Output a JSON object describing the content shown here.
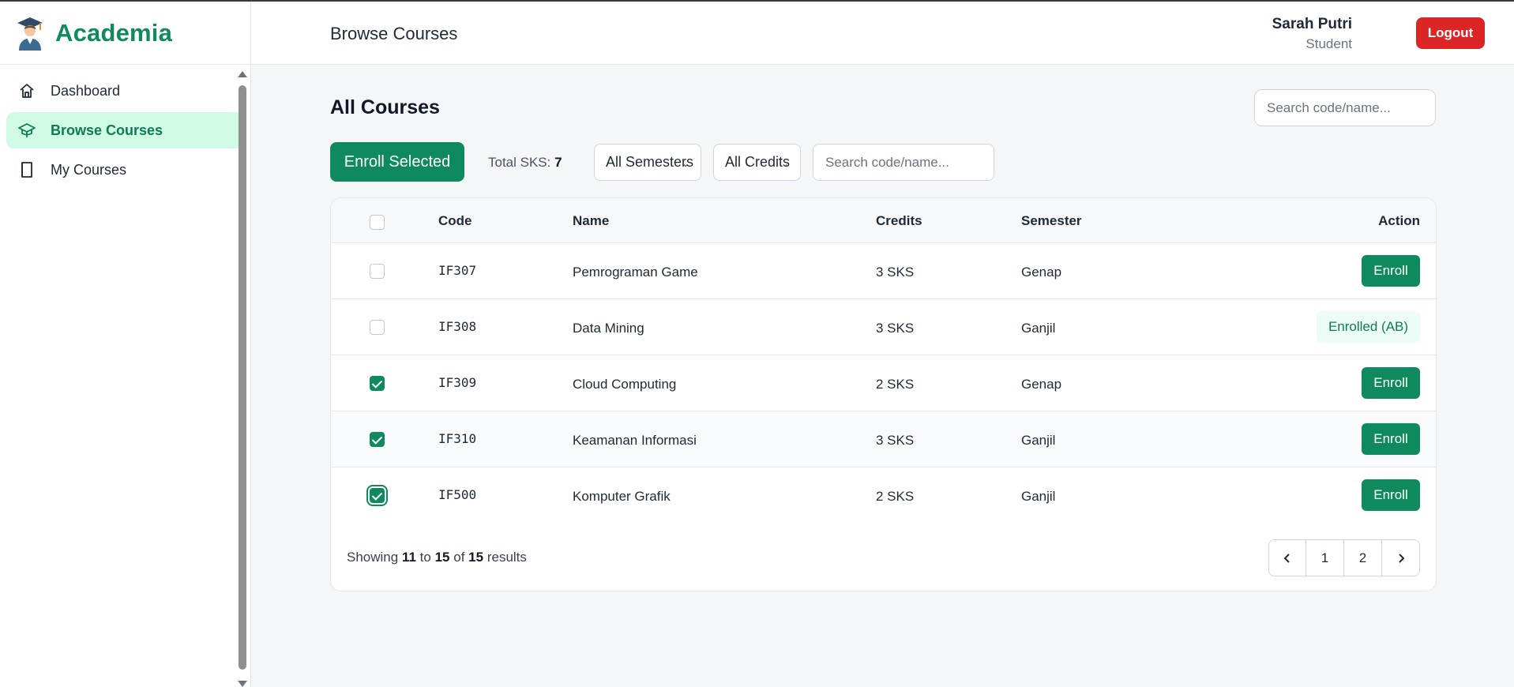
{
  "app": {
    "name": "Academia"
  },
  "sidebar": {
    "items": [
      {
        "label": "Dashboard",
        "icon": "home-icon",
        "active": false
      },
      {
        "label": "Browse Courses",
        "icon": "graduation-cap-icon",
        "active": true
      },
      {
        "label": "My Courses",
        "icon": "book-icon",
        "active": false
      }
    ]
  },
  "header": {
    "title": "Browse Courses",
    "user_name": "Sarah Putri",
    "user_role": "Student",
    "logout_label": "Logout"
  },
  "main": {
    "section_title": "All Courses",
    "search_placeholder": "Search code/name...",
    "enroll_selected_label": "Enroll Selected",
    "total_sks_label": "Total SKS:",
    "total_sks_value": "7",
    "semester_filter": "All Semesters",
    "credits_filter": "All Credits",
    "filter_search_placeholder": "Search code/name..."
  },
  "table": {
    "headers": {
      "code": "Code",
      "name": "Name",
      "credits": "Credits",
      "semester": "Semester",
      "action": "Action"
    },
    "rows": [
      {
        "code": "IF307",
        "name": "Pemrograman Game",
        "credits": "3 SKS",
        "semester": "Genap",
        "action": "Enroll",
        "checked": false
      },
      {
        "code": "IF308",
        "name": "Data Mining",
        "credits": "3 SKS",
        "semester": "Ganjil",
        "action": "Enrolled (AB)",
        "checked": false
      },
      {
        "code": "IF309",
        "name": "Cloud Computing",
        "credits": "2 SKS",
        "semester": "Genap",
        "action": "Enroll",
        "checked": true
      },
      {
        "code": "IF310",
        "name": "Keamanan Informasi",
        "credits": "3 SKS",
        "semester": "Ganjil",
        "action": "Enroll",
        "checked": true
      },
      {
        "code": "IF500",
        "name": "Komputer Grafik",
        "credits": "2 SKS",
        "semester": "Ganjil",
        "action": "Enroll",
        "checked": true
      }
    ]
  },
  "pagination": {
    "showing_prefix": "Showing",
    "from": "11",
    "to_word": "to",
    "to": "15",
    "of_word": "of",
    "total": "15",
    "results_word": "results",
    "pages": [
      "1",
      "2"
    ]
  },
  "colors": {
    "accent": "#0f8a5f",
    "danger": "#dc2626",
    "active_bg": "#d1fae5"
  }
}
